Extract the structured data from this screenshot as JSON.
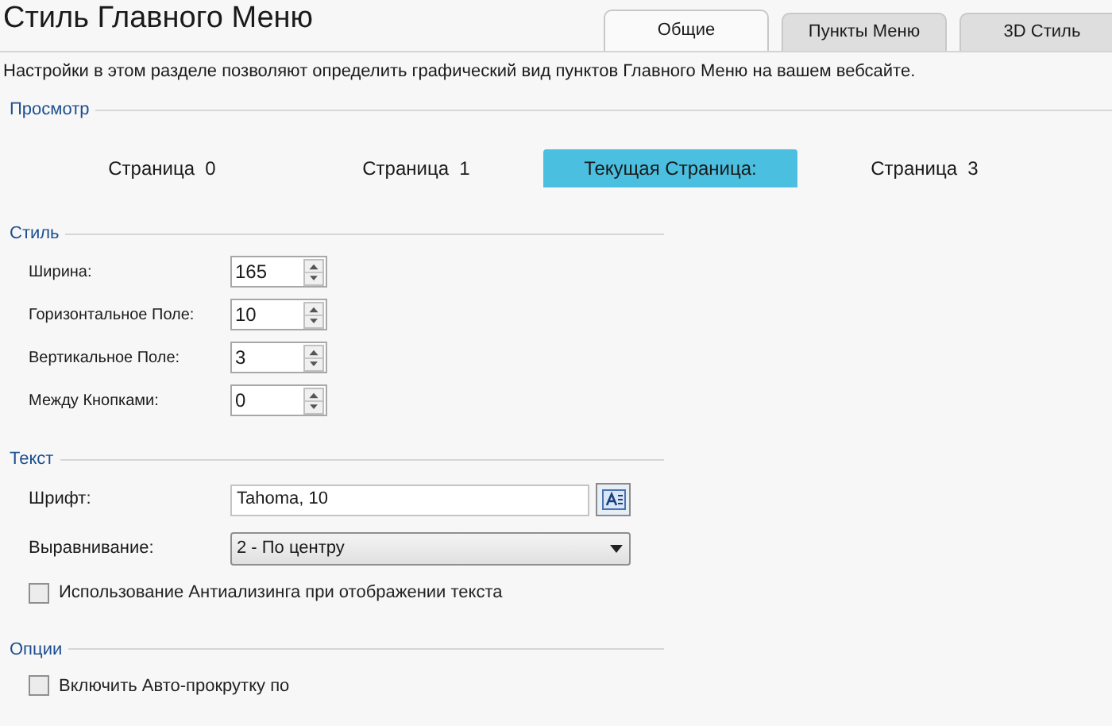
{
  "title": "Стиль Главного Меню",
  "tabs": [
    {
      "label": "Общие",
      "selected": true
    },
    {
      "label": "Пункты Меню",
      "selected": false
    },
    {
      "label": "3D Стиль",
      "selected": false
    }
  ],
  "description": "Настройки в этом разделе позволяют определить графический вид пунктов Главного Меню на вашем вебсайте.",
  "preview": {
    "heading": "Просмотр",
    "items": [
      {
        "label": "Страница  0",
        "selected": false
      },
      {
        "label": "Страница  1",
        "selected": false
      },
      {
        "label": "Текущая Страница:",
        "selected": true
      },
      {
        "label": "Страница  3",
        "selected": false
      }
    ]
  },
  "style": {
    "heading": "Стиль",
    "fields": [
      {
        "label": "Ширина:",
        "value": "165"
      },
      {
        "label": "Горизонтальное Поле:",
        "value": "10"
      },
      {
        "label": "Вертикальное Поле:",
        "value": "3"
      },
      {
        "label": "Между Кнопками:",
        "value": "0"
      }
    ]
  },
  "text": {
    "heading": "Текст",
    "font_label": "Шрифт:",
    "font_value": "Tahoma, 10",
    "align_label": "Выравнивание:",
    "align_value": "2 - По центру",
    "antialias": {
      "label": "Использование Антиализинга при отображении текста",
      "checked": false
    }
  },
  "options": {
    "heading": "Опции",
    "auto_scroll": {
      "label": "Включить Авто-прокрутку по",
      "checked": false
    }
  }
}
